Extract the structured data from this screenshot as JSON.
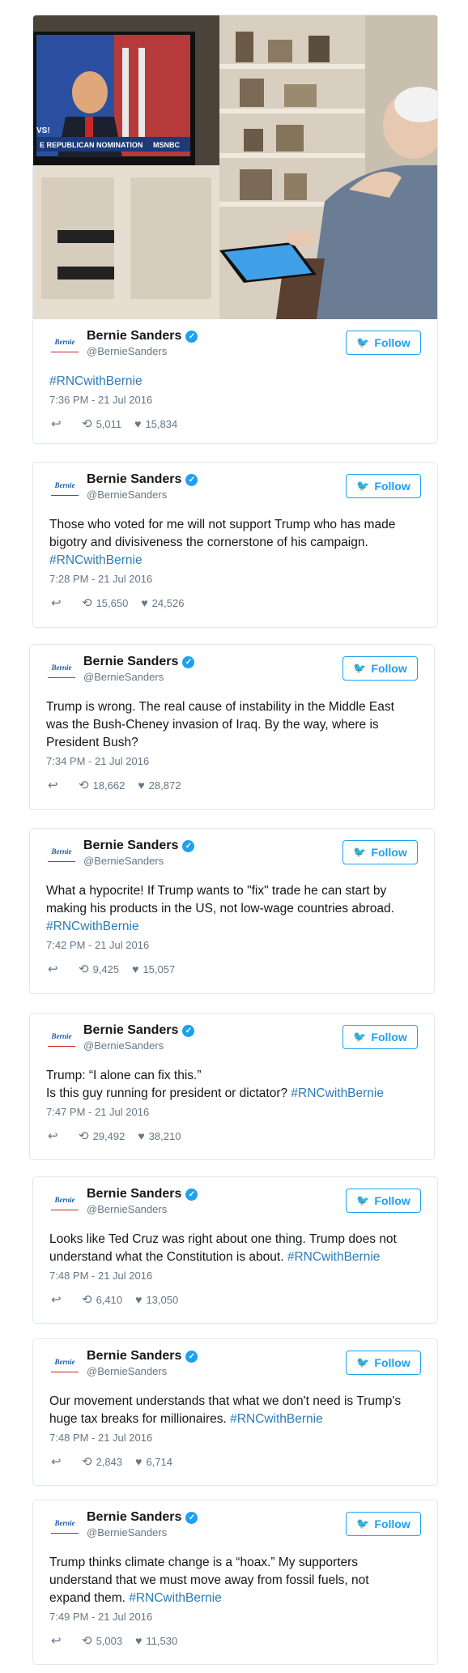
{
  "tweets": [
    {
      "name": "Bernie Sanders",
      "handle": "@BernieSanders",
      "logo": "Bernie",
      "follow": "Follow",
      "text": "",
      "tag": "#RNCwithBernie",
      "time": "7:36 PM - 21 Jul 2016",
      "retweets": "5,011",
      "likes": "15,834",
      "photo": {
        "tv_caption": "E REPUBLICAN NOMINATION",
        "tv_network": "MSNBC",
        "tv_corner": "VS!"
      }
    },
    {
      "name": "Bernie Sanders",
      "handle": "@BernieSanders",
      "logo": "Bernie",
      "follow": "Follow",
      "text": "Those who voted for me will not support Trump who has made\nbigotry and divisiveness the cornerstone of his campaign.\n",
      "tag": "#RNCwithBernie",
      "time": "7:28 PM - 21 Jul 2016",
      "retweets": "15,650",
      "likes": "24,526"
    },
    {
      "name": "Bernie Sanders",
      "handle": "@BernieSanders",
      "logo": "Bernie",
      "follow": "Follow",
      "text": "Trump is wrong. The real cause of instability in the Middle East\nwas the Bush-Cheney invasion of Iraq. By the way, where is\nPresident Bush?",
      "tag": "",
      "time": "7:34 PM - 21 Jul 2016",
      "retweets": "18,662",
      "likes": "28,872"
    },
    {
      "name": "Bernie Sanders",
      "handle": "@BernieSanders",
      "logo": "Bernie",
      "follow": "Follow",
      "text": "What a hypocrite! If Trump wants to \"fix\" trade he can start by\nmaking his products in the US, not low-wage countries abroad.\n",
      "tag": "#RNCwithBernie",
      "time": "7:42 PM - 21 Jul 2016",
      "retweets": "9,425",
      "likes": "15,057"
    },
    {
      "name": "Bernie Sanders",
      "handle": "@BernieSanders",
      "logo": "Bernie",
      "follow": "Follow",
      "text": "Trump: “I alone can fix this.”\nIs this guy running for president or dictator? ",
      "tag": "#RNCwithBernie",
      "time": "7:47 PM - 21 Jul 2016",
      "retweets": "29,492",
      "likes": "38,210"
    },
    {
      "name": "Bernie Sanders",
      "handle": "@BernieSanders",
      "logo": "Bernie",
      "follow": "Follow",
      "text": "Looks like Ted Cruz was right about one thing. Trump does not\nunderstand what the Constitution is about. ",
      "tag": "#RNCwithBernie",
      "time": "7:48 PM - 21 Jul 2016",
      "retweets": "6,410",
      "likes": "13,050"
    },
    {
      "name": "Bernie Sanders",
      "handle": "@BernieSanders",
      "logo": "Bernie",
      "follow": "Follow",
      "text": "Our movement understands that what we don't need is Trump's\nhuge tax breaks for millionaires. ",
      "tag": "#RNCwithBernie",
      "time": "7:48 PM - 21 Jul 2016",
      "retweets": "2,843",
      "likes": "6,714"
    },
    {
      "name": "Bernie Sanders",
      "handle": "@BernieSanders",
      "logo": "Bernie",
      "follow": "Follow",
      "text": "Trump thinks climate change is a “hoax.” My supporters\nunderstand that we must move away from fossil fuels, not\nexpand them. ",
      "tag": "#RNCwithBernie",
      "time": "7:49 PM - 21 Jul 2016",
      "retweets": "5,003",
      "likes": "11,530"
    }
  ],
  "icons": {
    "reply": "reply-icon",
    "retweet": "retweet-icon",
    "like": "heart-icon",
    "verified": "verified-badge-icon",
    "bird": "twitter-bird-icon"
  },
  "colors": {
    "accent": "#1da1f2",
    "hashtag": "#2b7bb9",
    "muted": "#657786",
    "border": "#e1e8ed"
  }
}
